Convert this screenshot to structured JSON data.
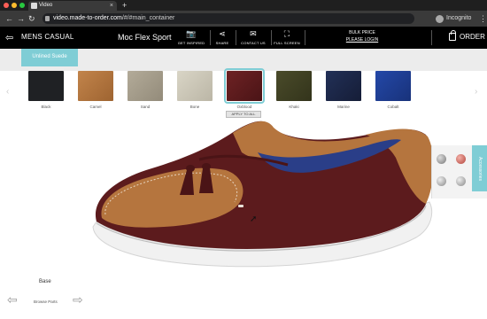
{
  "browser": {
    "tab_title": "Video",
    "tab_close": "×",
    "new_tab": "+",
    "url_host": "video.made-to-order.com",
    "url_path": "/#/#main_container",
    "profile": "Incognito",
    "back": "←",
    "forward": "→",
    "reload": "↻",
    "menu": "⋮"
  },
  "header": {
    "logo_icon": "⇦",
    "category": "MENS CASUAL",
    "model": "Moc Flex Sport",
    "buttons": [
      {
        "label": "GET INSPIRED",
        "icon": "📷"
      },
      {
        "label": "SHARE",
        "icon": "⋖"
      },
      {
        "label": "CONTACT US",
        "icon": "✉"
      },
      {
        "label": "FULL SCREEN",
        "icon": "⛶"
      }
    ],
    "bulk_price": "BULK PRICE",
    "login": "PLEASE LOGIN",
    "order": "ORDER"
  },
  "material_tab": "Unlined Suede",
  "nav_arrows": {
    "left": "‹",
    "right": "›"
  },
  "swatches": [
    {
      "name": "Black",
      "color": "#1f2124"
    },
    {
      "name": "Camel",
      "color": "#b5753e"
    },
    {
      "name": "Sand",
      "color": "#a59d8c"
    },
    {
      "name": "Bone",
      "color": "#cbc7b8"
    },
    {
      "name": "Oxblood",
      "color": "#5c1b1d",
      "selected": true
    },
    {
      "name": "Khaki",
      "color": "#3e3f22"
    },
    {
      "name": "Marine",
      "color": "#1b2645"
    },
    {
      "name": "Cobalt",
      "color": "#1e3f96"
    }
  ],
  "apply_all": "APPLY TO ALL",
  "accessories": {
    "tab_label": "Accessories",
    "items": [
      "tassel",
      "tassel",
      "tassel",
      "tassel"
    ]
  },
  "colors": {
    "accent": "#7fcdd5",
    "vamp": "#5c1b1d",
    "upper": "#b5753e",
    "sole": "#f4f4f4"
  },
  "bottom": {
    "section": "Base",
    "browse": "Browse Parts",
    "prev": "⇦",
    "next": "⇨"
  }
}
